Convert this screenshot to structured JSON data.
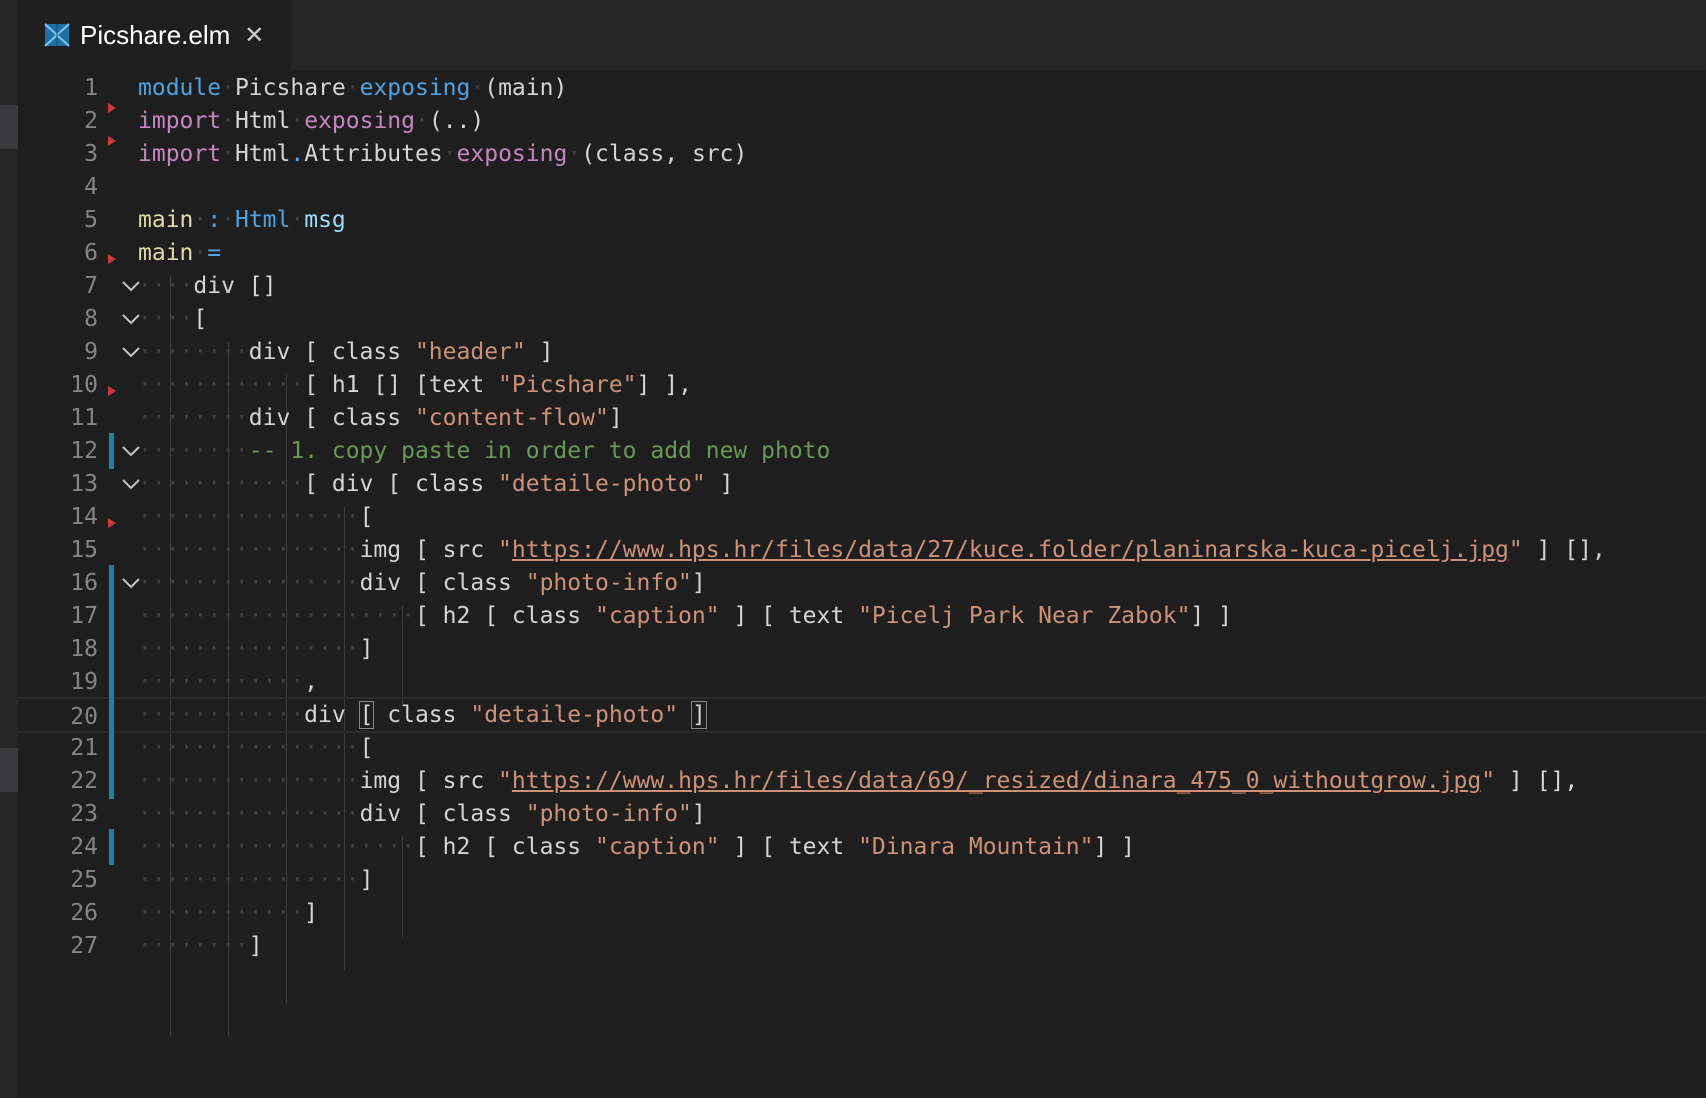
{
  "tab": {
    "title": "Picshare.elm",
    "close_glyph": "✕",
    "icon": "elm-file-icon"
  },
  "lines": [
    {
      "n": "1"
    },
    {
      "n": "2"
    },
    {
      "n": "3"
    },
    {
      "n": "4"
    },
    {
      "n": "5"
    },
    {
      "n": "6"
    },
    {
      "n": "7"
    },
    {
      "n": "8"
    },
    {
      "n": "9"
    },
    {
      "n": "10"
    },
    {
      "n": "11"
    },
    {
      "n": "12"
    },
    {
      "n": "13"
    },
    {
      "n": "14"
    },
    {
      "n": "15"
    },
    {
      "n": "16"
    },
    {
      "n": "17"
    },
    {
      "n": "18"
    },
    {
      "n": "19"
    },
    {
      "n": "20"
    },
    {
      "n": "21"
    },
    {
      "n": "22"
    },
    {
      "n": "23"
    },
    {
      "n": "24"
    },
    {
      "n": "25"
    },
    {
      "n": "26"
    },
    {
      "n": "27"
    }
  ],
  "code": {
    "l1": {
      "module": "module",
      "name": "Picshare",
      "exposing": "exposing",
      "rest": "(main)"
    },
    "l2": {
      "import": "import",
      "name": "Html",
      "exposing": "exposing",
      "rest": "(..)"
    },
    "l3": {
      "import": "import",
      "name": "Html",
      "dot": ".",
      "name2": "Attributes",
      "exposing": "exposing",
      "rest": "(class, src)"
    },
    "l5": {
      "name": "main",
      "colon": ":",
      "type1": "Html",
      "type2": "msg"
    },
    "l6": {
      "name": "main",
      "eq": "="
    },
    "l7": {
      "text": "div []"
    },
    "l8": {
      "text": "["
    },
    "l9": {
      "pre": "div [ class ",
      "str": "\"header\"",
      "post": " ]"
    },
    "l10": {
      "pre": "[ h1 [] [text ",
      "str": "\"Picshare\"",
      "post": "] ],"
    },
    "l11": {
      "pre": "div [ class ",
      "str": "\"content-flow\"",
      "post": "]"
    },
    "l12": {
      "comment": "-- 1. copy paste in order to add new photo"
    },
    "l13": {
      "pre": "[ div [ class ",
      "str": "\"detaile-photo\"",
      "post": " ]"
    },
    "l14": {
      "text": "["
    },
    "l15": {
      "pre": "img [ src ",
      "q1": "\"",
      "url": "https://www.hps.hr/files/data/27/kuce.folder/planinarska-kuca-picelj.jpg",
      "q2": "\"",
      "post": " ] [],"
    },
    "l16": {
      "pre": "div [ class ",
      "str": "\"photo-info\"",
      "post": "]"
    },
    "l17": {
      "pre": "[ h2 [ class ",
      "str": "\"caption\"",
      "mid": " ] [ text ",
      "str2": "\"Picelj Park Near Zabok\"",
      "post": "] ]"
    },
    "l18": {
      "text": "]"
    },
    "l19": {
      "text": ","
    },
    "l20": {
      "pre": "div ",
      "ob": "[",
      "mid": " class ",
      "str": "\"detaile-photo\"",
      "sp": " ",
      "cb": "]"
    },
    "l21": {
      "text": "["
    },
    "l22": {
      "pre": "img [ src ",
      "q1": "\"",
      "url": "https://www.hps.hr/files/data/69/_resized/dinara_475_0_withoutgrow.jpg",
      "q2": "\"",
      "post": " ] [],"
    },
    "l23": {
      "pre": "div [ class ",
      "str": "\"photo-info\"",
      "post": "]"
    },
    "l24": {
      "pre": "[ h2 [ class ",
      "str": "\"caption\"",
      "mid": " ] [ text ",
      "str2": "\"Dinara Mountain\"",
      "post": "] ]"
    },
    "l25": {
      "text": "]"
    },
    "l26": {
      "text": "]"
    },
    "l27": {
      "text": "]"
    }
  }
}
